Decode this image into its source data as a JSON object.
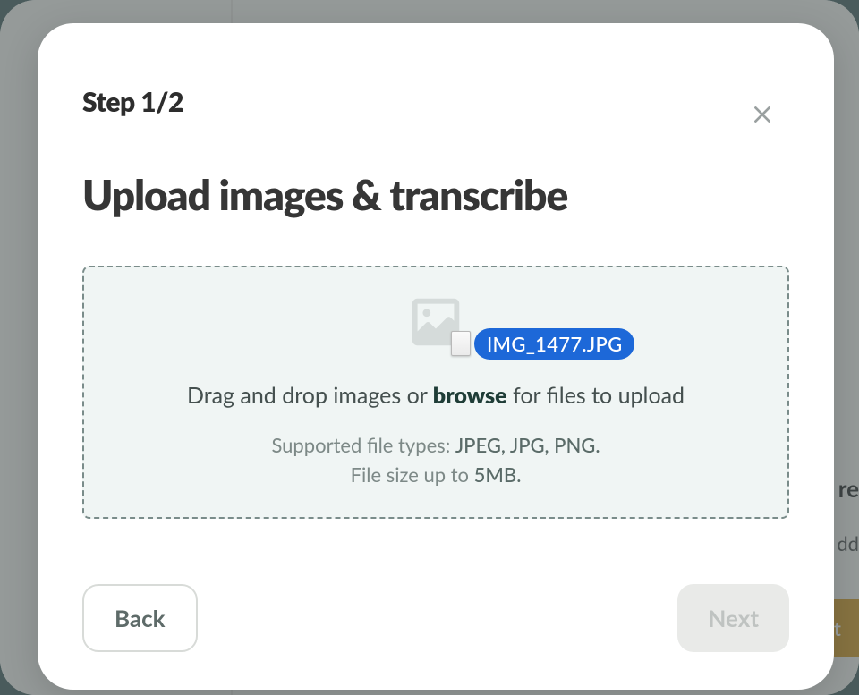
{
  "modal": {
    "step_label": "Step 1/2",
    "title": "Upload images & transcribe",
    "dropzone": {
      "text_before": "Drag and drop images or ",
      "browse_label": "browse",
      "text_after": " for files to upload",
      "supported_prefix": "Supported file types: ",
      "supported_types": "JPEG, JPG, PNG.",
      "size_prefix": "File size up to ",
      "size_value": "5MB."
    },
    "dragged_file": {
      "name": "IMG_1477.JPG"
    },
    "buttons": {
      "back": "Back",
      "next": "Next"
    }
  },
  "background": {
    "partial_text_1": "re",
    "partial_text_2": "dd",
    "partial_button": "ent"
  }
}
